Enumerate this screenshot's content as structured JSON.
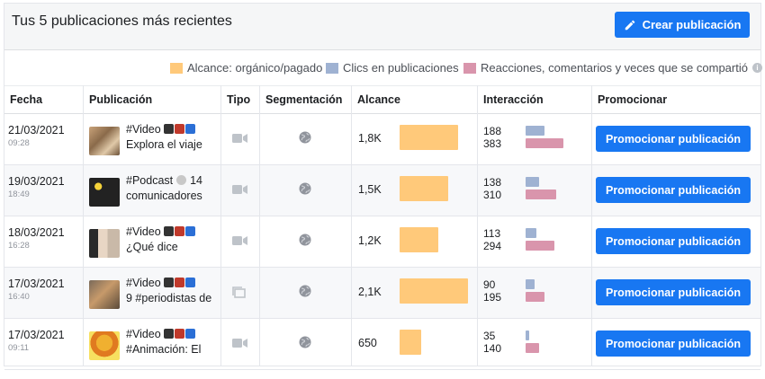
{
  "header": {
    "title": "Tus 5 publicaciones más recientes",
    "create_label": "Crear publicación"
  },
  "legend": [
    {
      "label": "Alcance: orgánico/pagado",
      "color": "#ffc97a"
    },
    {
      "label": "Clics en publicaciones",
      "color": "#9fb2d2"
    },
    {
      "label": "Reacciones, comentarios y veces que se compartió",
      "color": "#d995ac"
    }
  ],
  "columns": [
    "Fecha",
    "Publicación",
    "Tipo",
    "Segmentación",
    "Alcance",
    "Interacción",
    "Promocionar"
  ],
  "rows": [
    {
      "date": "21/03/2021",
      "time": "09:28",
      "line1": "#Video",
      "line2": "Explora el viaje",
      "type": "video",
      "reach": "1,8K",
      "reach_num": 1800,
      "clicks": "188",
      "clicks_num": 188,
      "reactions": "383",
      "reactions_num": 383,
      "promote": "Promocionar publicación"
    },
    {
      "date": "19/03/2021",
      "time": "18:49",
      "line1": "#Podcast",
      "line1_extra": "14",
      "line2": "comunicadores",
      "type": "video",
      "reach": "1,5K",
      "reach_num": 1500,
      "clicks": "138",
      "clicks_num": 138,
      "reactions": "310",
      "reactions_num": 310,
      "promote": "Promocionar publicación"
    },
    {
      "date": "18/03/2021",
      "time": "16:28",
      "line1": "#Video",
      "line2": "¿Qué dice",
      "type": "video",
      "reach": "1,2K",
      "reach_num": 1200,
      "clicks": "113",
      "clicks_num": 113,
      "reactions": "294",
      "reactions_num": 294,
      "promote": "Promocionar publicación"
    },
    {
      "date": "17/03/2021",
      "time": "16:40",
      "line1": "#Video",
      "line2": "9 #periodistas de",
      "type": "album",
      "reach": "2,1K",
      "reach_num": 2100,
      "clicks": "90",
      "clicks_num": 90,
      "reactions": "195",
      "reactions_num": 195,
      "promote": "Promocionar publicación"
    },
    {
      "date": "17/03/2021",
      "time": "09:11",
      "line1": "#Video",
      "line2": "#Animación: El",
      "type": "video",
      "reach": "650",
      "reach_num": 650,
      "clicks": "35",
      "clicks_num": 35,
      "reactions": "140",
      "reactions_num": 140,
      "promote": "Promocionar publicación"
    }
  ]
}
